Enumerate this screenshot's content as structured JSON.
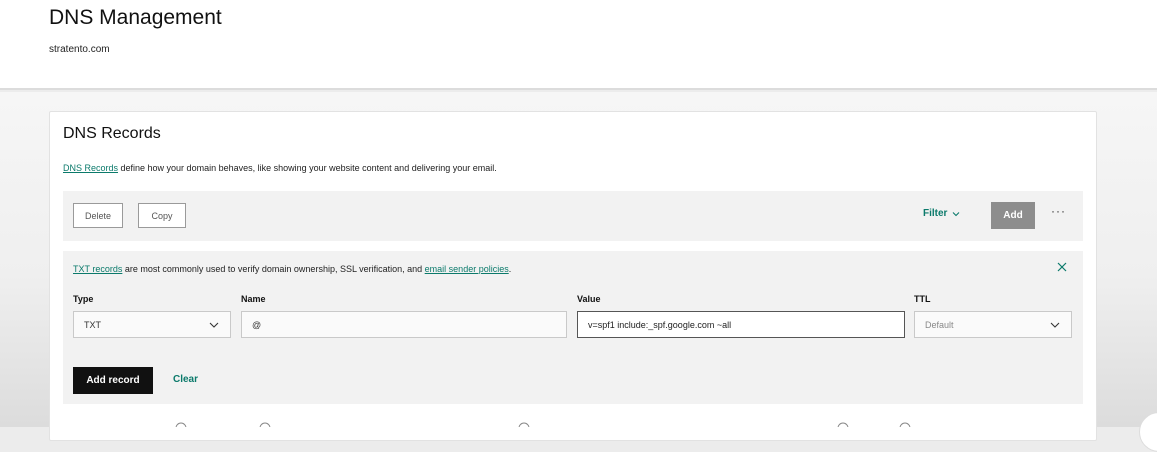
{
  "header": {
    "title": "DNS Management",
    "domain": "stratento.com"
  },
  "card": {
    "title": "DNS Records",
    "desc_link": "DNS Records",
    "desc_text": " define how your domain behaves, like showing your website content and delivering your email."
  },
  "toolbar": {
    "delete_label": "Delete",
    "copy_label": "Copy",
    "filter_label": "Filter",
    "add_label": "Add",
    "more_label": "···"
  },
  "form": {
    "info_link1": "TXT records",
    "info_text": " are most commonly used to verify domain ownership, SSL verification, and ",
    "info_link2": "email sender policies",
    "info_end": ".",
    "type_label": "Type",
    "type_value": "TXT",
    "name_label": "Name",
    "name_value": "@",
    "value_label": "Value",
    "value_value": "v=spf1 include:_spf.google.com ~all",
    "ttl_label": "TTL",
    "ttl_placeholder": "Default",
    "add_record_label": "Add record",
    "clear_label": "Clear"
  },
  "colors": {
    "accent": "#0b7a6b",
    "add_button": "#8d8d8d",
    "primary_button": "#111111"
  }
}
